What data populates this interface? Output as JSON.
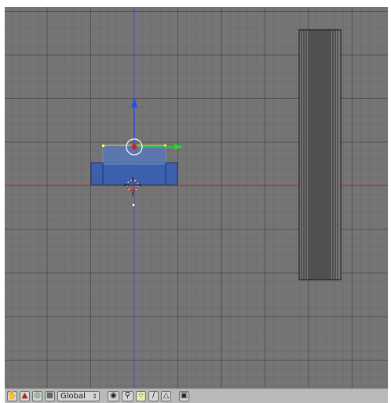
{
  "viewport": {
    "grid_color": "#757575",
    "axes": {
      "x_axis_color": "#cc4444",
      "y_axis_color": "#4444cc"
    },
    "manipulator": {
      "z_arrow_color": "#2a52d6",
      "y_arrow_color": "#33cc33"
    },
    "selected_object_color": "#3a5fb0",
    "wire_object_color": "#111111"
  },
  "toolbar": {
    "buttons": [
      {
        "name": "hand-icon",
        "glyph": "✋"
      },
      {
        "name": "transform-triangle-icon",
        "glyph": "▲"
      },
      {
        "name": "rotate-ring-icon",
        "glyph": "◎"
      },
      {
        "name": "scale-square-icon",
        "glyph": "■"
      }
    ],
    "orientation_select": "Global",
    "pivot_glyph": "◉",
    "snap_glyph": "⚲",
    "select_mode_buttons": [
      {
        "name": "vertex-select-icon",
        "glyph": "⁘"
      },
      {
        "name": "edge-select-icon",
        "glyph": "∕"
      },
      {
        "name": "face-select-icon",
        "glyph": "△"
      }
    ],
    "render_glyph": "▣"
  }
}
